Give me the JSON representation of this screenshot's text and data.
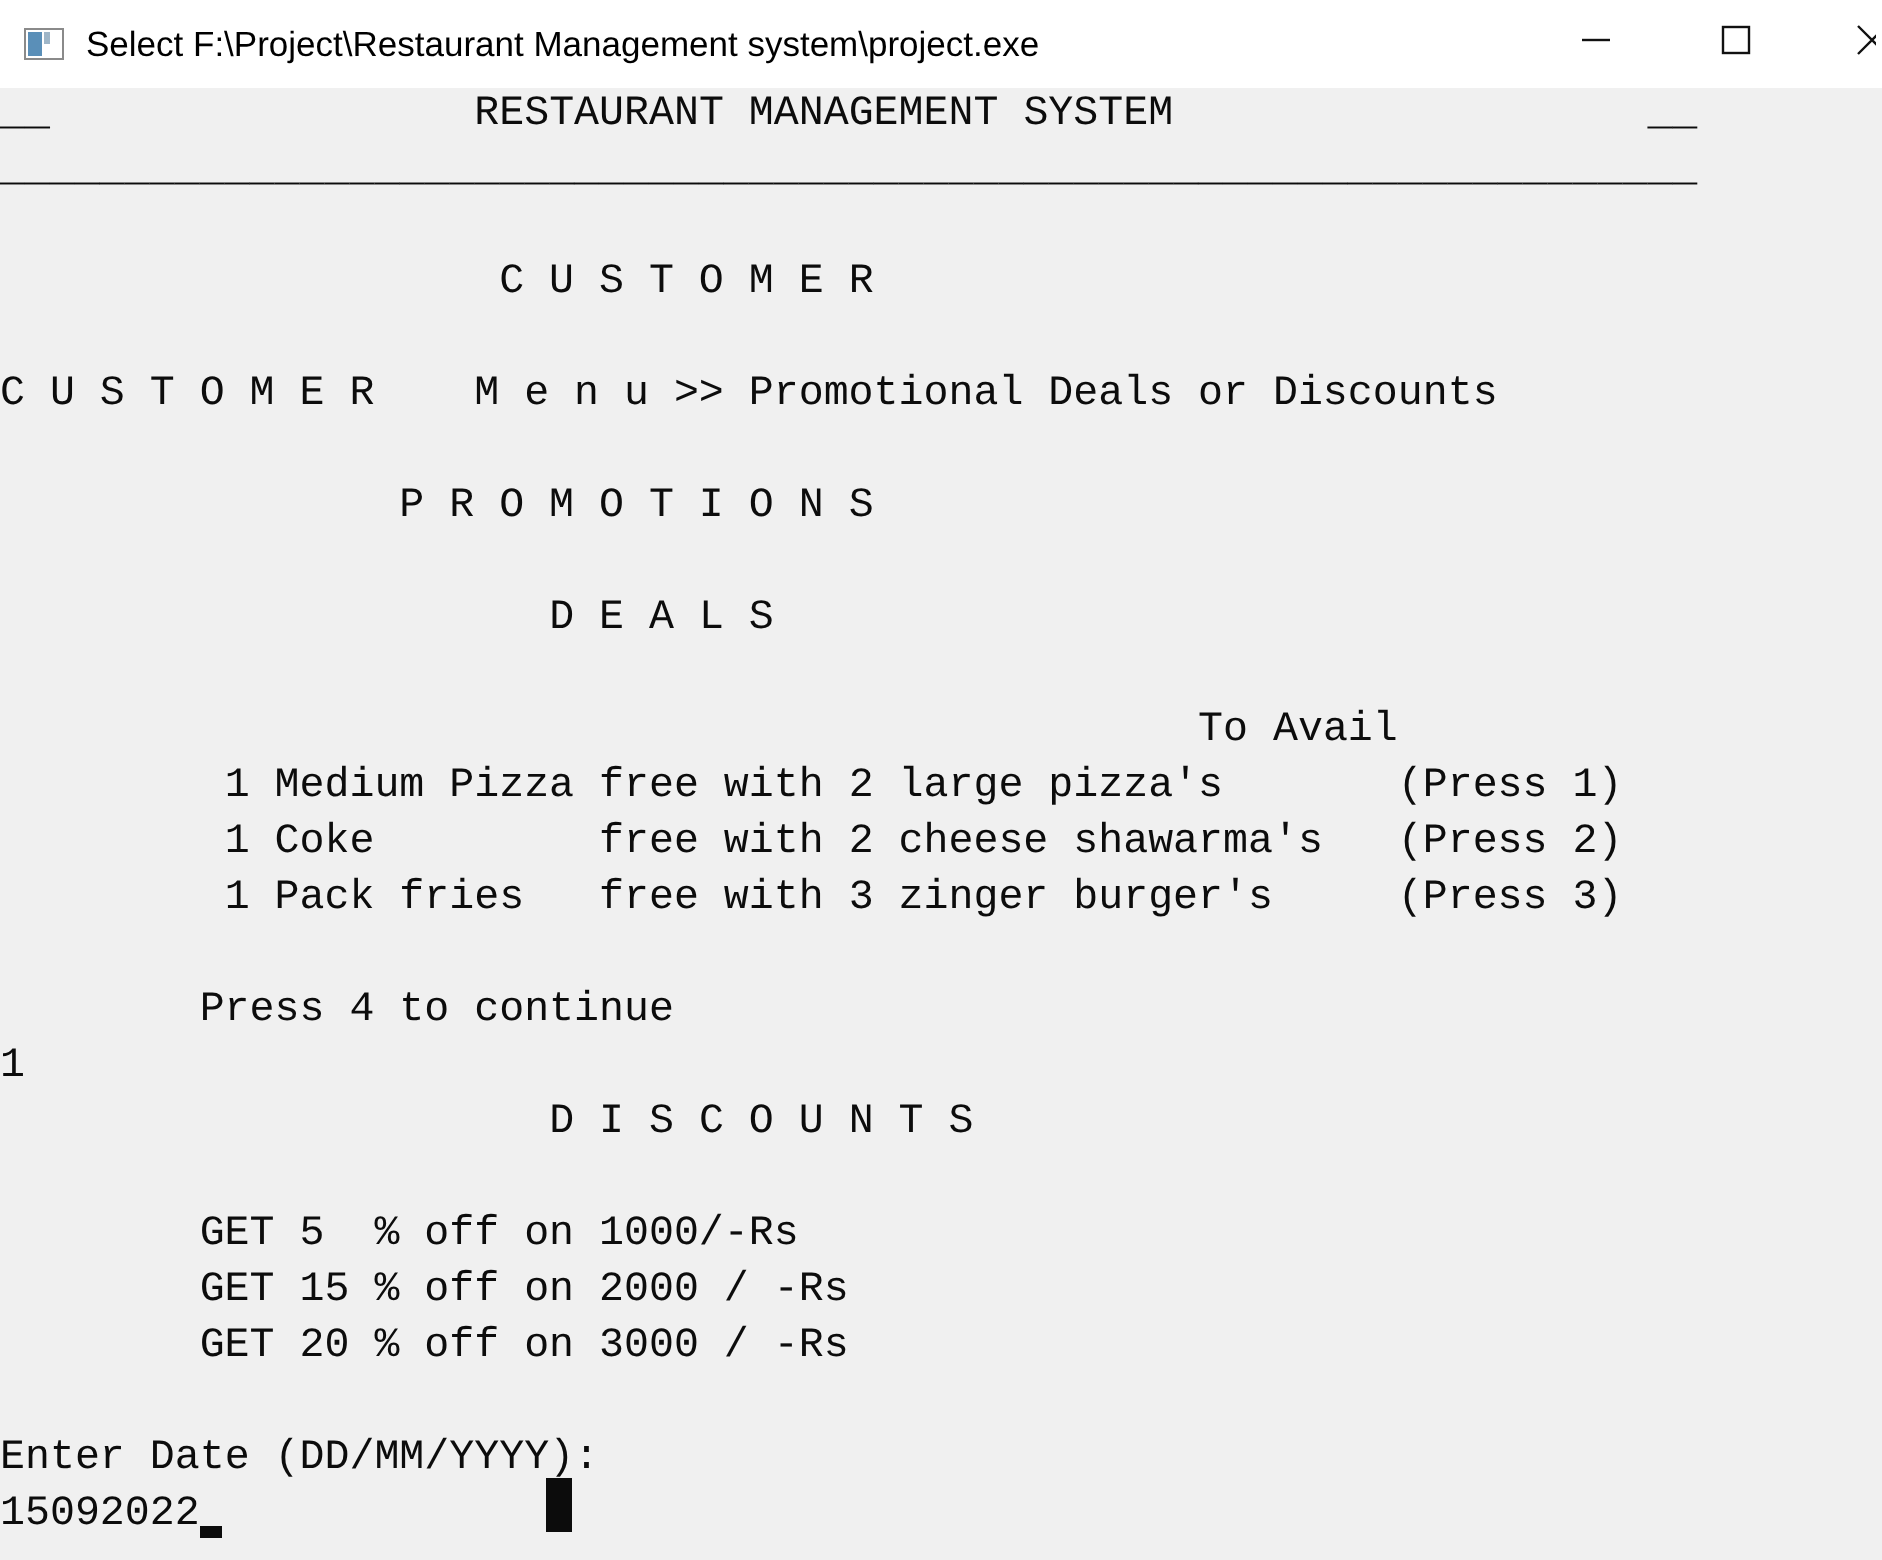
{
  "window": {
    "title": "Select F:\\Project\\Restaurant Management system\\project.exe"
  },
  "console": {
    "lines": [
      {
        "kind": "text",
        "segments": [
          "__",
          "                 RESTAURANT MANAGEMENT SYSTEM",
          "                   __"
        ]
      },
      {
        "kind": "text",
        "segments": [
          "____________________________________________________________________"
        ]
      },
      {
        "kind": "blank"
      },
      {
        "kind": "text",
        "segments": [
          "                    C U S T O M E R"
        ]
      },
      {
        "kind": "blank"
      },
      {
        "kind": "text",
        "segments": [
          "C U S T O M E R",
          "    M e n u >> Promotional Deals or Discounts"
        ]
      },
      {
        "kind": "blank"
      },
      {
        "kind": "text",
        "segments": [
          "                P R O M O T I O N S"
        ]
      },
      {
        "kind": "blank"
      },
      {
        "kind": "text",
        "segments": [
          "                      D E A L S"
        ]
      },
      {
        "kind": "blank"
      },
      {
        "kind": "text",
        "segments": [
          "                                                To Avail"
        ]
      },
      {
        "kind": "text",
        "segments": [
          "         1 Medium Pizza",
          " free with 2 large pizza's",
          "       (Press 1)"
        ]
      },
      {
        "kind": "text",
        "segments": [
          "         1 Coke",
          "         free with 2 cheese shawarma's",
          "   (Press 2)"
        ]
      },
      {
        "kind": "text",
        "segments": [
          "         1 Pack fries",
          "   free with 3 zinger burger's",
          "     (Press 3)"
        ]
      },
      {
        "kind": "blank"
      },
      {
        "kind": "text",
        "segments": [
          "        Press 4 to continue"
        ]
      },
      {
        "kind": "text",
        "segments": [
          "1"
        ]
      },
      {
        "kind": "text",
        "segments": [
          "                      D I S C O U N T S"
        ]
      },
      {
        "kind": "blank"
      },
      {
        "kind": "text",
        "segments": [
          "        GET 5  % off on 1000/-Rs"
        ]
      },
      {
        "kind": "text",
        "segments": [
          "        GET 15 % off on 2000 / -Rs"
        ]
      },
      {
        "kind": "text",
        "segments": [
          "        GET 20 % off on 3000 / -Rs"
        ]
      },
      {
        "kind": "blank"
      },
      {
        "kind": "text",
        "segments": [
          "Enter Date (DD/MM/YYYY):"
        ]
      },
      {
        "kind": "input",
        "value": "15092022"
      }
    ]
  }
}
